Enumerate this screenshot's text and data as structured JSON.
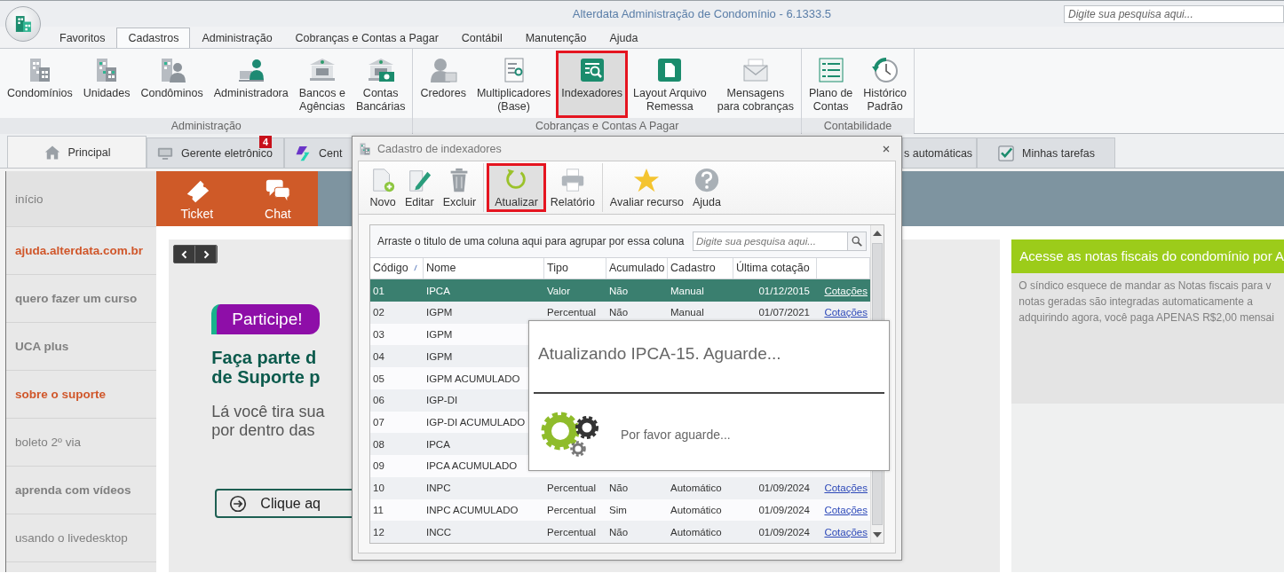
{
  "app": {
    "title": "Alterdata Administração de Condomínio - 6.1333.5",
    "search": {
      "placeholder": "Digite sua pesquisa aqui..."
    }
  },
  "menu": [
    {
      "label": "Favoritos",
      "selected": false
    },
    {
      "label": "Cadastros",
      "selected": true
    },
    {
      "label": "Administração",
      "selected": false
    },
    {
      "label": "Cobranças e Contas a Pagar",
      "selected": false
    },
    {
      "label": "Contábil",
      "selected": false
    },
    {
      "label": "Manutenção",
      "selected": false
    },
    {
      "label": "Ajuda",
      "selected": false
    }
  ],
  "ribbon": {
    "groups": [
      {
        "label": "Administração",
        "buttons": [
          {
            "label": "Condomínios",
            "selected": false
          },
          {
            "label": "Unidades",
            "selected": false
          },
          {
            "label": "Condôminos",
            "selected": false
          },
          {
            "label": "Administradora",
            "selected": false
          },
          {
            "label": "Bancos e\nAgências",
            "selected": false
          },
          {
            "label": "Contas\nBancárias",
            "selected": false
          }
        ]
      },
      {
        "label": "Cobranças e Contas A Pagar",
        "buttons": [
          {
            "label": "Credores",
            "selected": false
          },
          {
            "label": "Multiplicadores\n(Base)",
            "selected": false
          },
          {
            "label": "Indexadores",
            "selected": true
          },
          {
            "label": "Layout Arquivo\nRemessa",
            "selected": false
          },
          {
            "label": "Mensagens\npara cobranças",
            "selected": false
          }
        ]
      },
      {
        "label": "Contabilidade",
        "buttons": [
          {
            "label": "Plano de\nContas",
            "selected": false
          },
          {
            "label": "Histórico\nPadrão",
            "selected": false
          }
        ]
      }
    ]
  },
  "doc_tabs": [
    {
      "label": "Principal",
      "selected": true
    },
    {
      "label": "Gerente eletrônico",
      "selected": false,
      "badge": "4"
    },
    {
      "label": "Cent",
      "selected": false
    },
    {
      "label": "s automáticas",
      "selected": false
    },
    {
      "label": "Minhas tarefas",
      "selected": false
    }
  ],
  "sidebar": {
    "items": [
      {
        "label": "início",
        "kind": "plain"
      },
      {
        "label": "ajuda.alterdata.com.br",
        "kind": "highlight"
      },
      {
        "label": "quero fazer um curso",
        "kind": "bold"
      },
      {
        "label": "UCA plus",
        "kind": "bold"
      },
      {
        "label": "sobre o suporte",
        "kind": "highlight"
      },
      {
        "label": "boleto 2º via",
        "kind": "plain"
      },
      {
        "label": "aprenda com vídeos",
        "kind": "bold"
      },
      {
        "label": "usando o livedesktop",
        "kind": "plain"
      }
    ]
  },
  "quick_actions": [
    "Ticket",
    "Chat"
  ],
  "banner": {
    "badge": "Participe!",
    "heading": "Faça parte d\nde Suporte p",
    "text": "Lá você tira sua\npor dentro das",
    "button": "Clique aq"
  },
  "promo": {
    "title": "Acesse as notas fiscais do condomínio por A",
    "lines": [
      "O síndico esquece de mandar as Notas fiscais para v",
      "notas geradas são integradas automaticamente a",
      "adquirindo agora, você paga APENAS R$2,00 mensai"
    ]
  },
  "dialog": {
    "title": "Cadastro de indexadores",
    "toolbar": {
      "groups": [
        {
          "buttons": [
            {
              "label": "Novo",
              "selected": false
            },
            {
              "label": "Editar",
              "selected": false
            },
            {
              "label": "Excluir",
              "selected": false
            }
          ]
        },
        {
          "buttons": [
            {
              "label": "Atualizar",
              "selected": true
            },
            {
              "label": "Relatório",
              "selected": false
            }
          ]
        },
        {
          "buttons": [
            {
              "label": "Avaliar recurso",
              "selected": false
            },
            {
              "label": "Ajuda",
              "selected": false
            }
          ]
        }
      ]
    },
    "group_hint": "Arraste o titulo de uma coluna aqui para agrupar por essa coluna",
    "search": {
      "placeholder": "Digite sua pesquisa aqui..."
    },
    "table": {
      "columns": [
        {
          "label": "Código",
          "sorted": true
        },
        {
          "label": "Nome",
          "sorted": false
        },
        {
          "label": "Tipo",
          "sorted": false
        },
        {
          "label": "Acumulado",
          "sorted": false
        },
        {
          "label": "Cadastro",
          "sorted": false
        },
        {
          "label": "Última cotação",
          "sorted": false
        }
      ],
      "rows": [
        {
          "code": "01",
          "name": "IPCA",
          "type": "Valor",
          "accumulated": "Não",
          "registration": "Manual",
          "last_quote": "01/12/2015",
          "link": "Cotações",
          "selected": true
        },
        {
          "code": "02",
          "name": "IGPM",
          "type": "Percentual",
          "accumulated": "Não",
          "registration": "Manual",
          "last_quote": "01/07/2021",
          "link": "Cotações",
          "selected": false
        },
        {
          "code": "03",
          "name": "IGPM",
          "selected": false
        },
        {
          "code": "04",
          "name": "IGPM",
          "selected": false
        },
        {
          "code": "05",
          "name": "IGPM ACUMULADO",
          "selected": false
        },
        {
          "code": "06",
          "name": "IGP-DI",
          "selected": false
        },
        {
          "code": "07",
          "name": "IGP-DI ACUMULADO",
          "selected": false
        },
        {
          "code": "08",
          "name": "IPCA",
          "selected": false
        },
        {
          "code": "09",
          "name": "IPCA ACUMULADO",
          "selected": false
        },
        {
          "code": "10",
          "name": "INPC",
          "type": "Percentual",
          "accumulated": "Não",
          "registration": "Automático",
          "last_quote": "01/09/2024",
          "link": "Cotações",
          "selected": false
        },
        {
          "code": "11",
          "name": "INPC ACUMULADO",
          "type": "Percentual",
          "accumulated": "Sim",
          "registration": "Automático",
          "last_quote": "01/09/2024",
          "link": "Cotações",
          "selected": false
        },
        {
          "code": "12",
          "name": "INCC",
          "type": "Percentual",
          "accumulated": "Não",
          "registration": "Automático",
          "last_quote": "01/09/2024",
          "link": "Cotações",
          "selected": false
        }
      ]
    },
    "progress": {
      "title": "Atualizando IPCA-15. Aguarde...",
      "message": "Por favor aguarde..."
    }
  }
}
